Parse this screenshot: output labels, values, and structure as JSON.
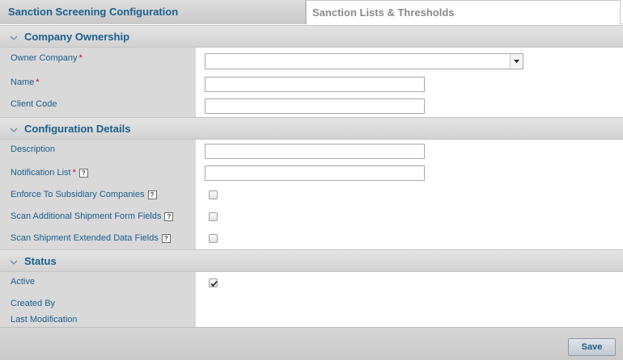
{
  "tabs": [
    {
      "label": "Sanction Screening Configuration",
      "active": true
    },
    {
      "label": "Sanction Lists & Thresholds",
      "active": false
    }
  ],
  "sections": {
    "ownership": {
      "title": "Company Ownership",
      "owner_company": {
        "label": "Owner Company",
        "required": "*",
        "value": ""
      },
      "name": {
        "label": "Name",
        "required": "*",
        "value": ""
      },
      "client_code": {
        "label": "Client Code",
        "value": ""
      }
    },
    "config": {
      "title": "Configuration Details",
      "description": {
        "label": "Description",
        "value": ""
      },
      "notification_list": {
        "label": "Notification List",
        "required": "*",
        "help": "?",
        "value": ""
      },
      "enforce_subsidiary": {
        "label": "Enforce To Subsidiary Companies",
        "help": "?",
        "checked": false
      },
      "scan_additional": {
        "label": "Scan Additional Shipment Form Fields",
        "help": "?",
        "checked": false
      },
      "scan_extended": {
        "label": "Scan Shipment Extended Data Fields",
        "help": "?",
        "checked": false
      }
    },
    "status": {
      "title": "Status",
      "active": {
        "label": "Active",
        "checked": true
      },
      "created_by": {
        "label": "Created By",
        "value": ""
      },
      "last_modification": {
        "label": "Last Modification",
        "value": ""
      }
    }
  },
  "footer": {
    "save_label": "Save"
  },
  "icons": {
    "section_toggle": "chevron-down-icon",
    "select_arrow": "triangle-down-icon",
    "help": "help-icon",
    "check": "checkmark-icon"
  },
  "colors": {
    "label_text": "#1b5f8c",
    "required": "#d0021b",
    "label_column": "#d9d9d9"
  }
}
